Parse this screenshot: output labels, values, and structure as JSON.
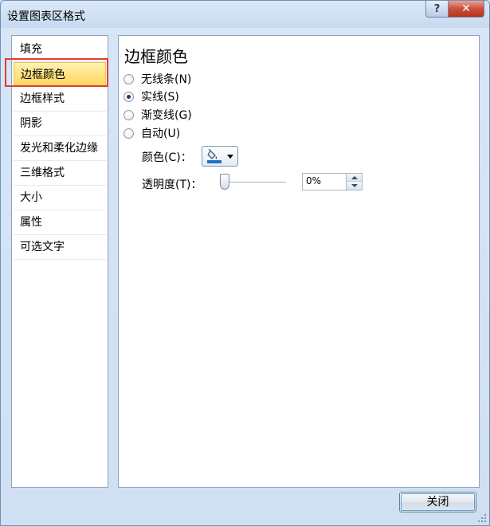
{
  "window": {
    "title": "设置图表区格式",
    "help_label": "?",
    "close_label": "✕"
  },
  "nav": {
    "items": [
      {
        "label": "填充"
      },
      {
        "label": "边框颜色"
      },
      {
        "label": "边框样式"
      },
      {
        "label": "阴影"
      },
      {
        "label": "发光和柔化边缘"
      },
      {
        "label": "三维格式"
      },
      {
        "label": "大小"
      },
      {
        "label": "属性"
      },
      {
        "label": "可选文字"
      }
    ],
    "selected_label": "边框颜色"
  },
  "panel": {
    "title": "边框颜色",
    "options": [
      {
        "label": "无线条(N)",
        "checked": false
      },
      {
        "label": "实线(S)",
        "checked": true
      },
      {
        "label": "渐变线(G)",
        "checked": false
      },
      {
        "label": "自动(U)",
        "checked": false
      }
    ],
    "color_label": "颜色(C)：",
    "color_swatch": "#1f6fc4",
    "transparency_label": "透明度(T)：",
    "transparency_value": "0%",
    "transparency_fraction": 0.0
  },
  "footer": {
    "close_label": "关闭"
  }
}
